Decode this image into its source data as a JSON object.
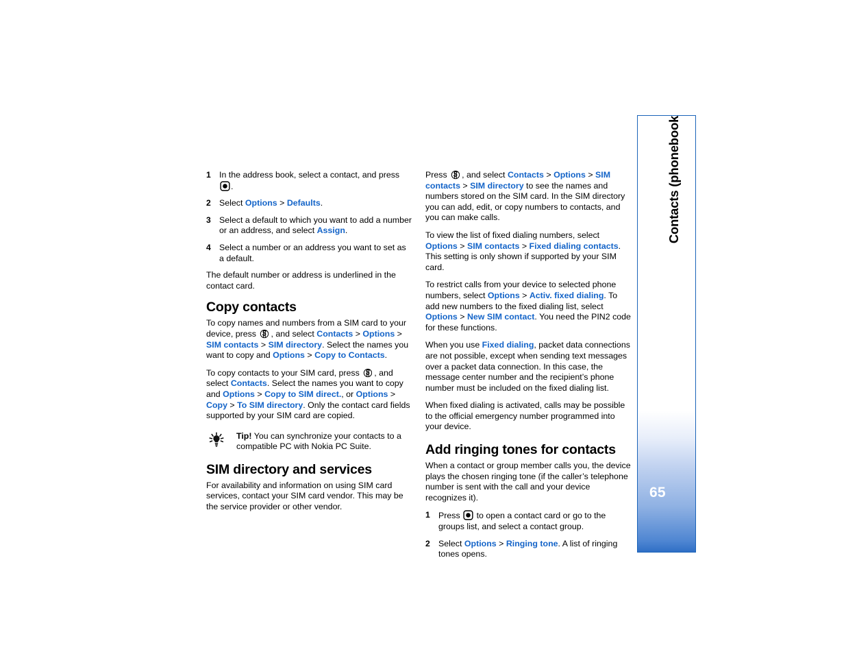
{
  "document": {
    "page_number": "65",
    "sidebar_title": "Contacts (phonebook)",
    "link_color": "#1464c8",
    "sidebar_border_color": "#1a63b8",
    "sidebar_gradient_end_color": "#2b6cc4"
  },
  "left_column": {
    "defaults_steps": [
      {
        "num": "1",
        "parts": [
          {
            "t": "text",
            "v": "In the address book, select a contact, and press "
          },
          {
            "t": "icon",
            "v": "select-key-icon"
          },
          {
            "t": "text",
            "v": "."
          }
        ]
      },
      {
        "num": "2",
        "parts": [
          {
            "t": "text",
            "v": "Select "
          },
          {
            "t": "link",
            "v": "Options"
          },
          {
            "t": "sep",
            "v": " > "
          },
          {
            "t": "link",
            "v": "Defaults"
          },
          {
            "t": "text",
            "v": "."
          }
        ]
      },
      {
        "num": "3",
        "parts": [
          {
            "t": "text",
            "v": "Select a default to which you want to add a number or an address, and select "
          },
          {
            "t": "link",
            "v": "Assign"
          },
          {
            "t": "text",
            "v": "."
          }
        ]
      },
      {
        "num": "4",
        "parts": [
          {
            "t": "text",
            "v": "Select a number or an address you want to set as a default."
          }
        ]
      }
    ],
    "defaults_note": "The default number or address is underlined in the contact card.",
    "copy_contacts_heading": "Copy contacts",
    "copy_para_1": [
      {
        "t": "text",
        "v": "To copy names and numbers from a SIM card to your device, press "
      },
      {
        "t": "icon",
        "v": "menu-key-icon"
      },
      {
        "t": "text",
        "v": ", and select "
      },
      {
        "t": "link",
        "v": "Contacts"
      },
      {
        "t": "sep",
        "v": " > "
      },
      {
        "t": "link",
        "v": "Options"
      },
      {
        "t": "sep",
        "v": " > "
      },
      {
        "t": "link",
        "v": "SIM contacts"
      },
      {
        "t": "sep",
        "v": " > "
      },
      {
        "t": "link",
        "v": "SIM directory"
      },
      {
        "t": "text",
        "v": ". Select the names you want to copy and "
      },
      {
        "t": "link",
        "v": "Options"
      },
      {
        "t": "sep",
        "v": " > "
      },
      {
        "t": "link",
        "v": "Copy to Contacts"
      },
      {
        "t": "text",
        "v": "."
      }
    ],
    "copy_para_2": [
      {
        "t": "text",
        "v": "To copy contacts to your SIM card, press "
      },
      {
        "t": "icon",
        "v": "menu-key-icon"
      },
      {
        "t": "text",
        "v": ", and select "
      },
      {
        "t": "link",
        "v": "Contacts"
      },
      {
        "t": "text",
        "v": ". Select the names you want to copy and "
      },
      {
        "t": "link",
        "v": "Options"
      },
      {
        "t": "sep",
        "v": " > "
      },
      {
        "t": "link",
        "v": "Copy to SIM direct."
      },
      {
        "t": "text",
        "v": ", or "
      },
      {
        "t": "link",
        "v": "Options"
      },
      {
        "t": "sep",
        "v": " > "
      },
      {
        "t": "link",
        "v": "Copy"
      },
      {
        "t": "sep",
        "v": " > "
      },
      {
        "t": "link",
        "v": "To SIM directory"
      },
      {
        "t": "text",
        "v": ". Only the contact card fields supported by your SIM card are copied."
      }
    ],
    "tip": {
      "icon": "lightbulb-tip-icon",
      "label": "Tip!",
      "text": " You can synchronize your contacts to a compatible PC with Nokia PC Suite."
    },
    "sim_directory_heading": "SIM directory and services",
    "sim_directory_para": "For availability and information on using SIM card services, contact your SIM card vendor. This may be the service provider or other vendor."
  },
  "right_column": {
    "sim_para_1": [
      {
        "t": "text",
        "v": "Press "
      },
      {
        "t": "icon",
        "v": "menu-key-icon"
      },
      {
        "t": "text",
        "v": ", and select "
      },
      {
        "t": "link",
        "v": "Contacts"
      },
      {
        "t": "sep",
        "v": " > "
      },
      {
        "t": "link",
        "v": "Options"
      },
      {
        "t": "sep",
        "v": " > "
      },
      {
        "t": "link",
        "v": "SIM contacts"
      },
      {
        "t": "sep",
        "v": " > "
      },
      {
        "t": "link",
        "v": "SIM directory"
      },
      {
        "t": "text",
        "v": " to see the names and numbers stored on the SIM card. In the SIM directory you can add, edit, or copy numbers to contacts, and you can make calls."
      }
    ],
    "sim_para_2": [
      {
        "t": "text",
        "v": "To view the list of fixed dialing numbers, select "
      },
      {
        "t": "link",
        "v": "Options"
      },
      {
        "t": "sep",
        "v": " > "
      },
      {
        "t": "link",
        "v": "SIM contacts"
      },
      {
        "t": "sep",
        "v": " > "
      },
      {
        "t": "link",
        "v": "Fixed dialing contacts"
      },
      {
        "t": "text",
        "v": ". This setting is only shown if supported by your SIM card."
      }
    ],
    "sim_para_3": [
      {
        "t": "text",
        "v": "To restrict calls from your device to selected phone numbers, select "
      },
      {
        "t": "link",
        "v": "Options"
      },
      {
        "t": "sep",
        "v": " > "
      },
      {
        "t": "link",
        "v": "Activ. fixed dialing"
      },
      {
        "t": "text",
        "v": ". To add new numbers to the fixed dialing list, select "
      },
      {
        "t": "link",
        "v": "Options"
      },
      {
        "t": "sep",
        "v": " > "
      },
      {
        "t": "link",
        "v": "New SIM contact"
      },
      {
        "t": "text",
        "v": ". You need the PIN2 code for these functions."
      }
    ],
    "sim_para_4": [
      {
        "t": "text",
        "v": "When you use "
      },
      {
        "t": "link",
        "v": "Fixed dialing"
      },
      {
        "t": "text",
        "v": ", packet data connections are not possible, except when sending text messages over a packet data connection. In this case, the message center number and the recipient’s phone number must be included on the fixed dialing list."
      }
    ],
    "sim_para_5": "When fixed dialing is activated, calls may be possible to the official emergency number programmed into your device.",
    "ringing_heading": "Add ringing tones for contacts",
    "ringing_intro": "When a contact or group member calls you, the device plays the chosen ringing tone (if the caller’s telephone number is sent with the call and your device recognizes it).",
    "ringing_steps": [
      {
        "num": "1",
        "parts": [
          {
            "t": "text",
            "v": "Press "
          },
          {
            "t": "icon",
            "v": "select-key-icon"
          },
          {
            "t": "text",
            "v": " to open a contact card or go to the groups list, and select a contact group."
          }
        ]
      },
      {
        "num": "2",
        "parts": [
          {
            "t": "text",
            "v": "Select "
          },
          {
            "t": "link",
            "v": "Options"
          },
          {
            "t": "sep",
            "v": " > "
          },
          {
            "t": "link",
            "v": "Ringing tone"
          },
          {
            "t": "text",
            "v": ". A list of ringing tones opens."
          }
        ]
      }
    ]
  }
}
